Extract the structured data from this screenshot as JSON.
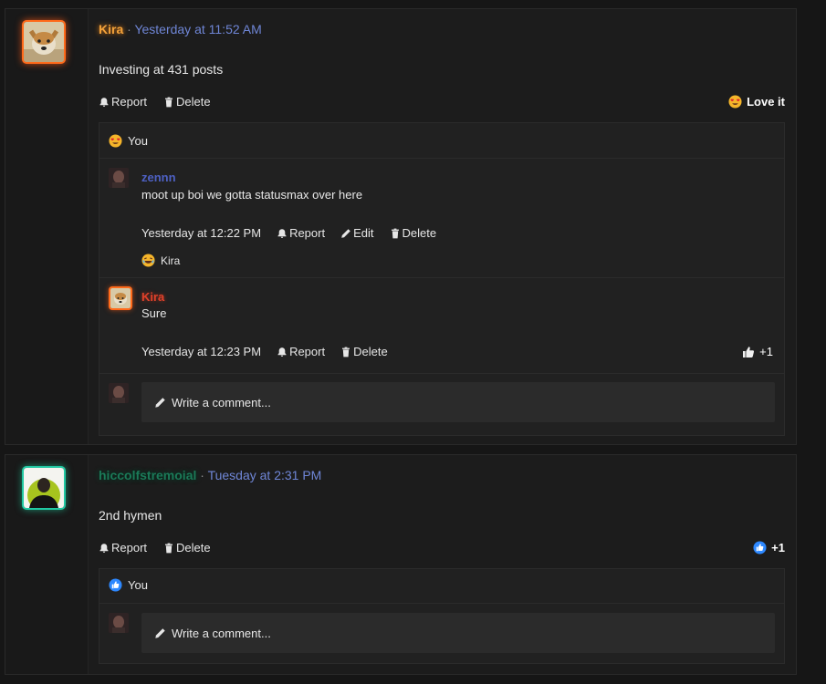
{
  "posts": [
    {
      "author": "Kira",
      "separator": "·",
      "timestamp": "Yesterday at 11:52 AM",
      "message": "Investing at 431 posts",
      "actions": {
        "report": "Report",
        "delete": "Delete"
      },
      "reaction": {
        "label": "Love it",
        "icon": "heart-eyes-emoji"
      },
      "reacted_by": "You",
      "comments": [
        {
          "author": "zennn",
          "text": "moot up boi we gotta statusmax over here",
          "timestamp": "Yesterday at 12:22 PM",
          "actions": {
            "report": "Report",
            "edit": "Edit",
            "delete": "Delete"
          },
          "reacted_by": "Kira",
          "reaction_icon": "laughing-emoji"
        },
        {
          "author": "Kira",
          "text": "Sure",
          "timestamp": "Yesterday at 12:23 PM",
          "actions": {
            "report": "Report",
            "delete": "Delete"
          },
          "like_count": "+1"
        }
      ],
      "write_comment_placeholder": "Write a comment..."
    },
    {
      "author": "hiccolfstremoial",
      "separator": "·",
      "timestamp": "Tuesday at 2:31 PM",
      "message": "2nd hymen",
      "actions": {
        "report": "Report",
        "delete": "Delete"
      },
      "like_count": "+1",
      "reacted_by": "You",
      "write_comment_placeholder": "Write a comment..."
    }
  ],
  "colors": {
    "timestamp": "#6f86d6",
    "kira_name": "#f3a23a",
    "zennn_name": "#4e61c4",
    "like_blue": "#2d88ff"
  }
}
